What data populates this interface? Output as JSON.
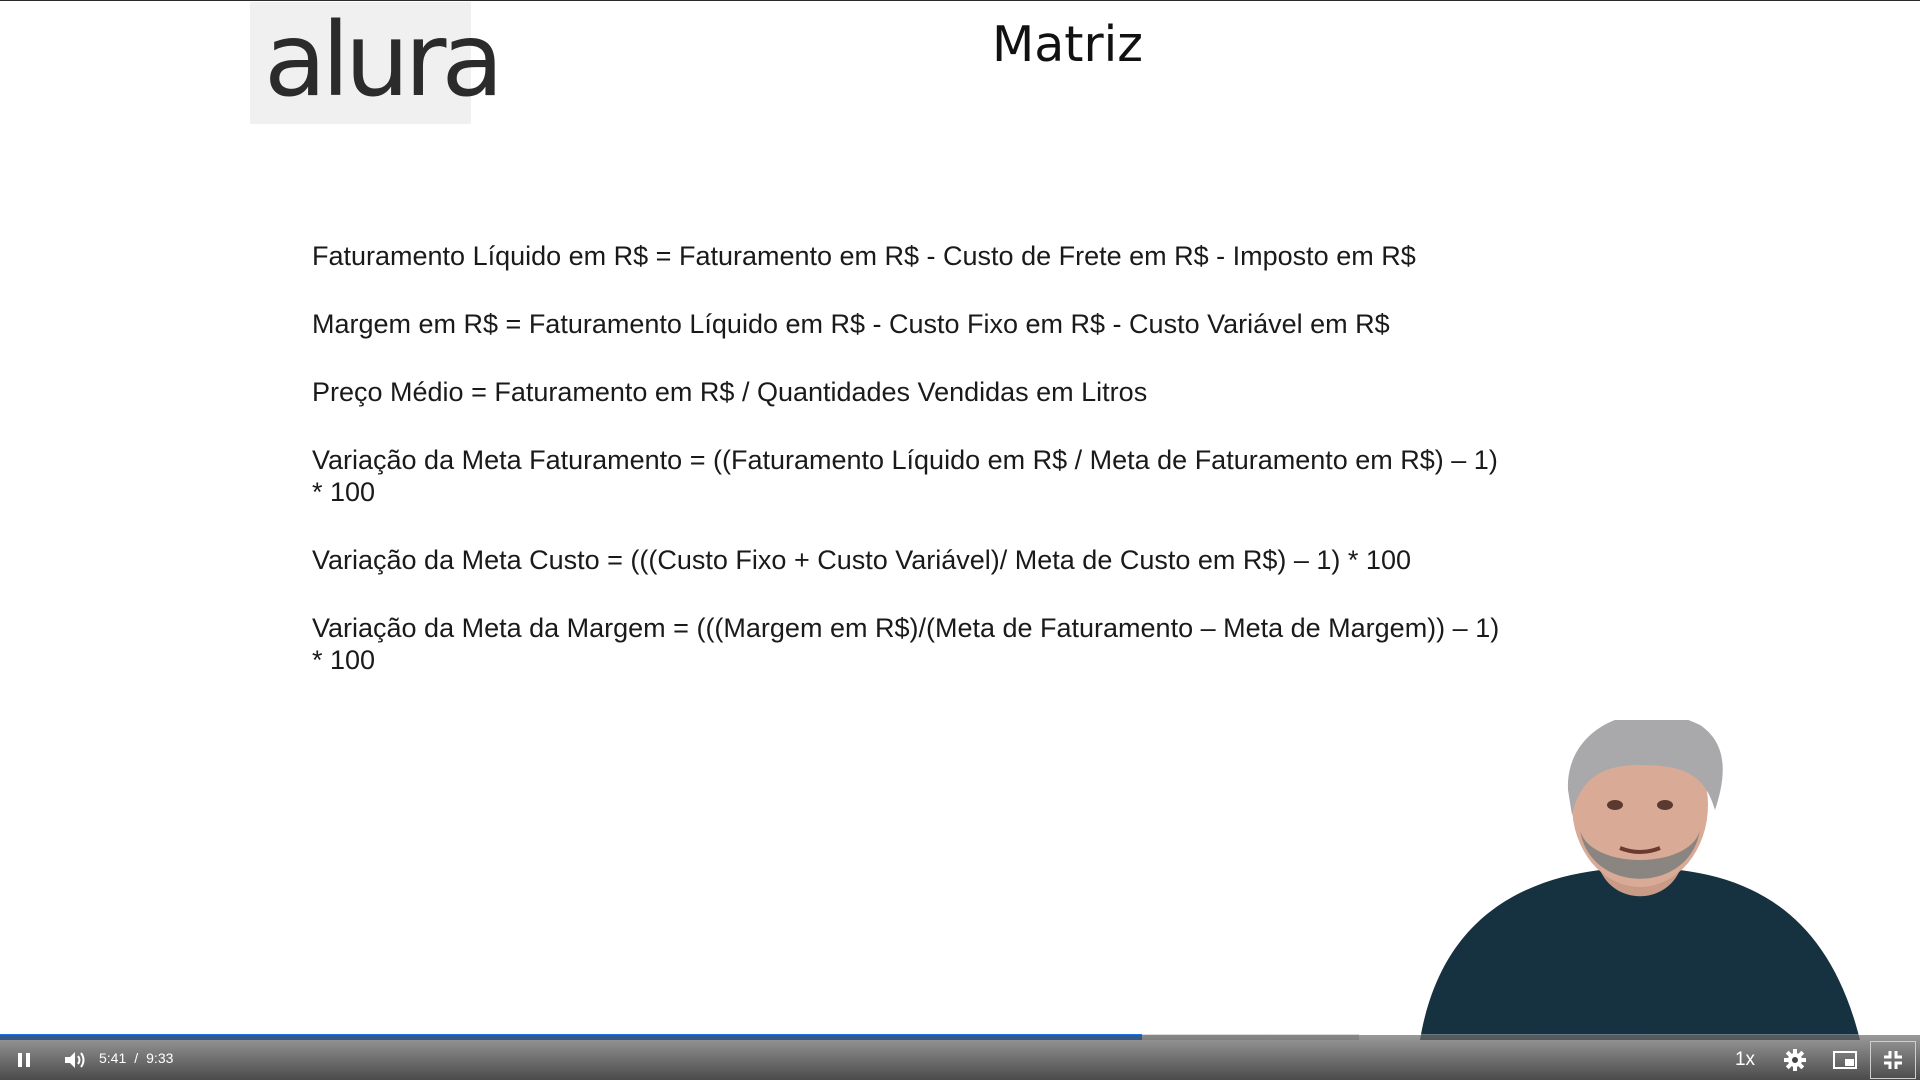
{
  "slide": {
    "logo_text": "alura",
    "title": "Matriz",
    "formulas": [
      "Faturamento Líquido em R$ = Faturamento em R$ - Custo de Frete em R$ - Imposto em R$",
      "Margem em R$ = Faturamento Líquido em R$ - Custo Fixo em R$ - Custo Variável em R$",
      "Preço Médio = Faturamento em R$ / Quantidades Vendidas em Litros",
      "Variação da Meta Faturamento = ((Faturamento Líquido em R$ / Meta de Faturamento em R$) – 1)\n* 100",
      "Variação da Meta Custo = (((Custo Fixo + Custo Variável)/ Meta de Custo em R$) – 1) * 100",
      "Variação da Meta da Margem = (((Margem em R$)/(Meta de Faturamento – Meta de Margem)) – 1)\n* 100"
    ]
  },
  "player": {
    "current_time": "5:41",
    "separator": "/",
    "duration": "9:33",
    "played_fraction": 0.595,
    "buffered_fraction": 0.708,
    "speed_label": "1x",
    "accent_color": "#1e74e6",
    "icons": {
      "pause": "pause-icon",
      "volume": "volume-icon",
      "settings": "gear-icon",
      "pip": "picture-in-picture-icon",
      "fullscreen": "exit-fullscreen-icon"
    }
  }
}
